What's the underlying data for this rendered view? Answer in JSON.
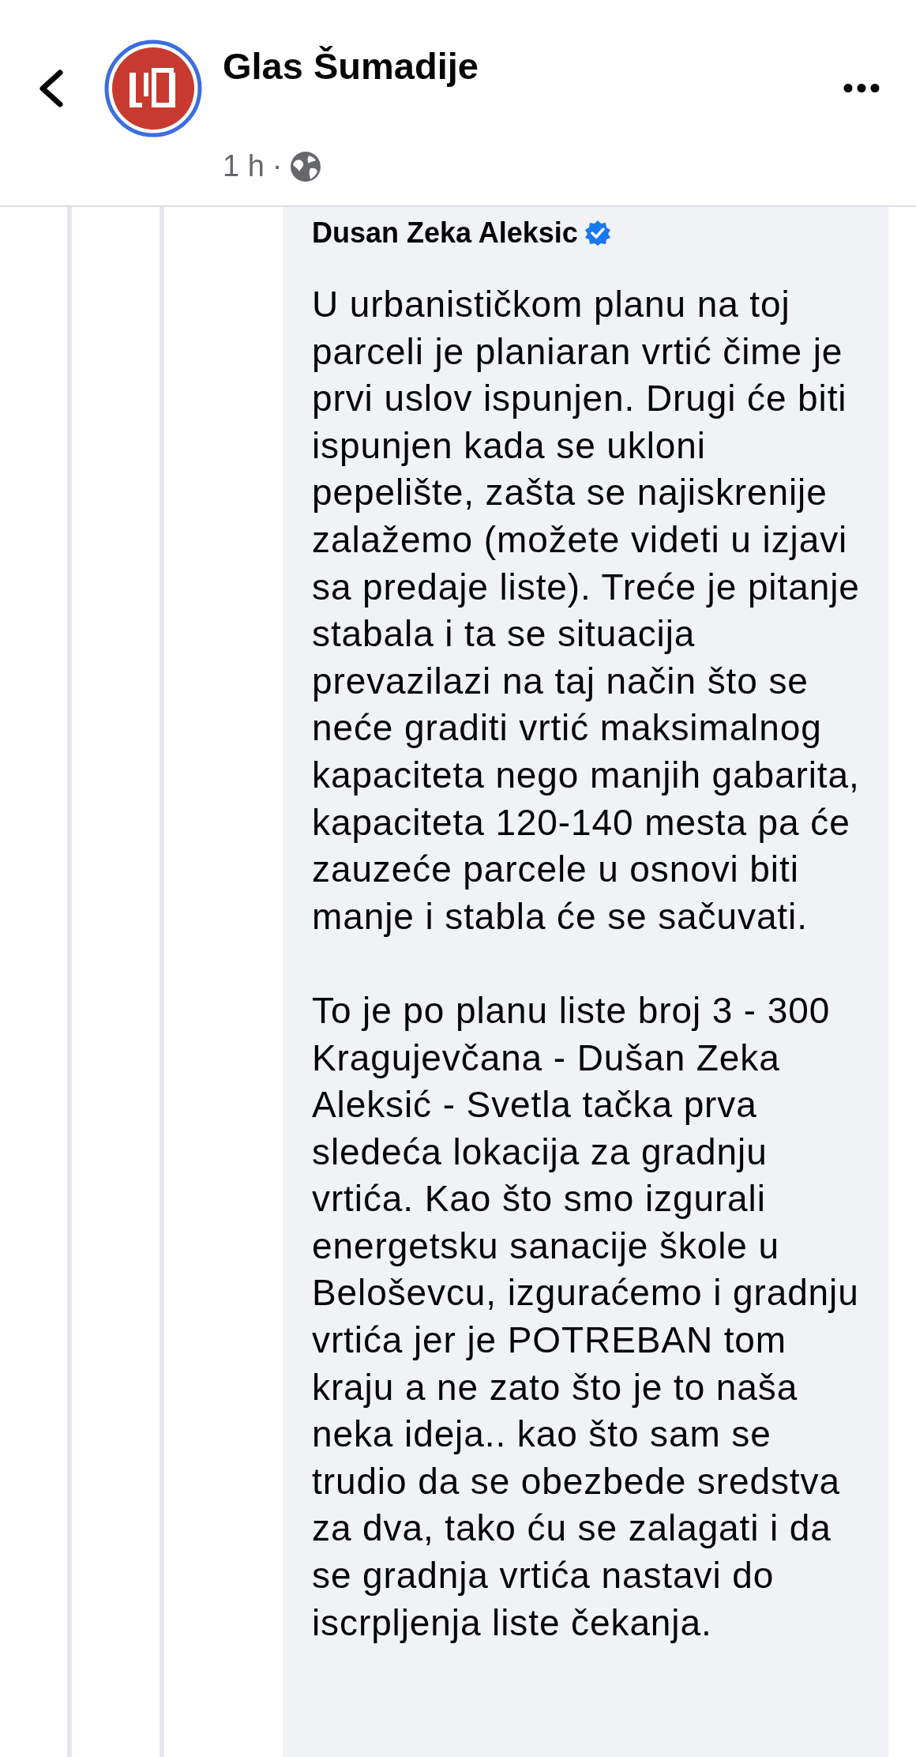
{
  "header": {
    "page_name": "Glas Šumadije",
    "time": "1 h",
    "separator": "·"
  },
  "comment": {
    "author": "Dusan Zeka Aleksic",
    "verified": true,
    "paragraphs": [
      "U urbanističkom planu na toj parceli je planiaran vrtić čime je prvi uslov ispunjen. Drugi će biti ispunjen kada se ukloni pepelište, zašta se najiskrenije zalažemo (možete videti u izjavi sa predaje liste). Treće je pitanje stabala i ta se situacija prevazilazi na taj način što se neće graditi vrtić maksimalnog kapaciteta nego manjih gabarita, kapaciteta 120-140 mesta pa će zauzeće parcele u osnovi biti manje i stabla će se sačuvati.",
      "To je po planu liste broj 3 - 300 Kragujevčana - Dušan Zeka Aleksić - Svetla tačka prva sledeća lokacija za gradnju vrtića. Kao što smo izgurali energetsku sanacije škole u Beloševcu, izguraćemo i gradnju vrtića jer je POTREBAN tom kraju a ne zato što je to naša neka ideja.. kao što sam se trudio da se obezbede sredstva za dva, tako ću se zalagati i da se gradnja vrtića nastavi do iscrpljenja liste čekanja."
    ]
  }
}
